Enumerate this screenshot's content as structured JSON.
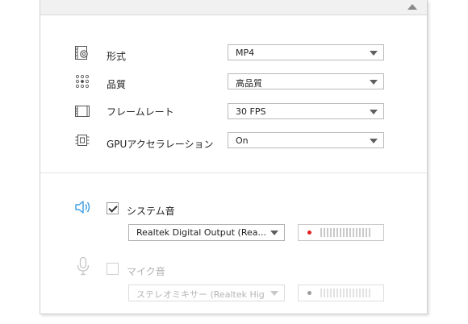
{
  "settings": {
    "format": {
      "label": "形式",
      "value": "MP4",
      "icon": "format-gear-icon"
    },
    "quality": {
      "label": "品質",
      "value": "高品質",
      "icon": "quality-dots-icon"
    },
    "framerate": {
      "label": "フレームレート",
      "value": "30 FPS",
      "icon": "film-strip-icon"
    },
    "gpu": {
      "label": "GPUアクセラレーション",
      "value": "On",
      "icon": "chip-icon"
    }
  },
  "audio": {
    "system": {
      "label": "システム音",
      "checked": true,
      "device": "Realtek Digital Output (Rea...",
      "icon": "speaker-icon"
    },
    "mic": {
      "label": "マイク音",
      "checked": false,
      "device": "ステレオミキサー (Realtek Hig...",
      "icon": "microphone-icon"
    }
  },
  "colors": {
    "accent_blue": "#3d9be0",
    "record_red": "#e02020",
    "disabled_gray": "#c0c0c0"
  }
}
